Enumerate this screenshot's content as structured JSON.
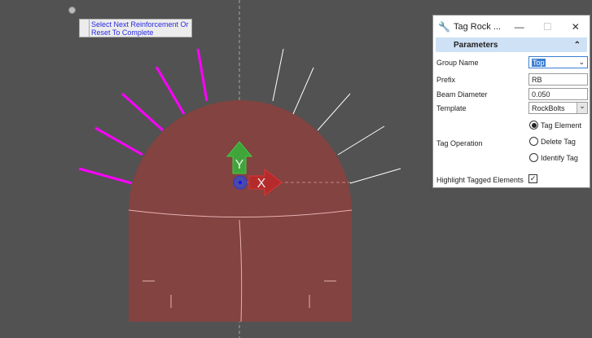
{
  "tooltip": {
    "line1": "Select Next Reinforcement Or",
    "line2": "Reset To Complete"
  },
  "dialog": {
    "title": "Tag Rock ...",
    "minimize": "—",
    "maximize": "☐",
    "close": "✕",
    "section": "Parameters",
    "collapse": "⌃",
    "group_name": {
      "label": "Group Name",
      "value": "Top"
    },
    "prefix": {
      "label": "Prefix",
      "value": "RB"
    },
    "beam_diameter": {
      "label": "Beam Diameter",
      "value": "0.050"
    },
    "template": {
      "label": "Template",
      "value": "RockBolts"
    },
    "tag_operation": {
      "label": "Tag Operation",
      "options": [
        "Tag Element",
        "Delete Tag",
        "Identify Tag"
      ],
      "selected": "Tag Element"
    },
    "highlight": {
      "label": "Highlight Tagged Elements",
      "checked": true,
      "mark": "✓"
    }
  },
  "view": {
    "x_axis_label": "X",
    "y_axis_label": "Y",
    "tunnel_color": "#824341",
    "tagged_bolt_color": "#ff00ff",
    "untagged_bolt_color": "#ffffff"
  }
}
